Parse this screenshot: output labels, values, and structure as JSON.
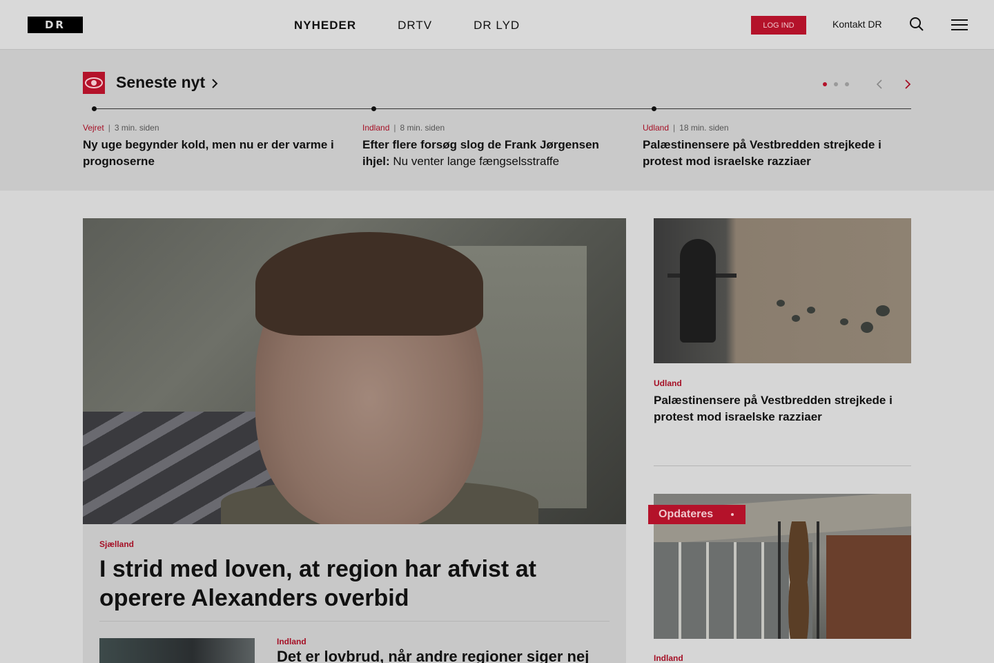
{
  "header": {
    "logo": "DR",
    "nav": [
      "NYHEDER",
      "DRTV",
      "DR LYD"
    ],
    "login_label": "LOG IND",
    "contact_label": "Kontakt DR"
  },
  "latest": {
    "title": "Seneste nyt",
    "items": [
      {
        "category": "Vejret",
        "time": "3 min. siden",
        "headline_bold": "Ny uge begynder kold, men nu er der varme i prognoserne",
        "headline_light": ""
      },
      {
        "category": "Indland",
        "time": "8 min. siden",
        "headline_bold": "Efter flere forsøg slog de Frank Jørgensen ihjel:",
        "headline_light": " Nu venter lange fængselsstraffe"
      },
      {
        "category": "Udland",
        "time": "18 min. siden",
        "headline_bold": "Palæstinensere på Vestbredden strejkede i protest mod israelske razziaer",
        "headline_light": ""
      }
    ],
    "pager": {
      "count": 3,
      "active": 0
    }
  },
  "hero": {
    "category": "Sjælland",
    "title": "I strid med loven, at region har afvist at operere Alexanders overbid",
    "sub_category": "Indland",
    "sub_title": "Det er lovbrud, når andre regioner siger nej"
  },
  "side1": {
    "category": "Udland",
    "title": "Palæstinensere på Vestbredden strejkede i protest mod israelske razziaer"
  },
  "side2": {
    "badge": "Opdateres",
    "category": "Indland"
  },
  "colors": {
    "accent": "#b4122a"
  }
}
